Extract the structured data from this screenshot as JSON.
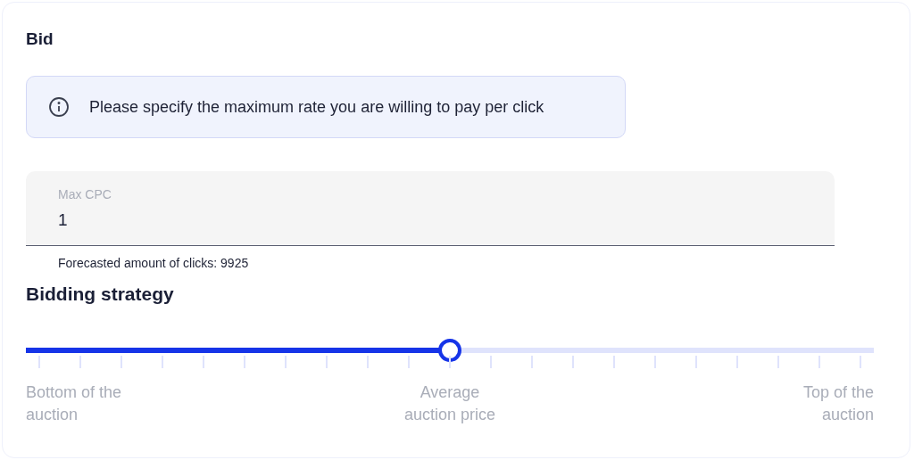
{
  "section_title": "Bid",
  "info": {
    "text": "Please specify the maximum rate you are willing to pay per click"
  },
  "max_cpc": {
    "label": "Max CPC",
    "value": "1",
    "helper": "Forecasted amount of clicks: 9925"
  },
  "strategy": {
    "title": "Bidding strategy",
    "slider": {
      "level": 0.5
    },
    "labels": [
      {
        "text": "Bottom of the auction"
      },
      {
        "text": "Average auction price"
      },
      {
        "text": "Top of the auction"
      }
    ]
  }
}
